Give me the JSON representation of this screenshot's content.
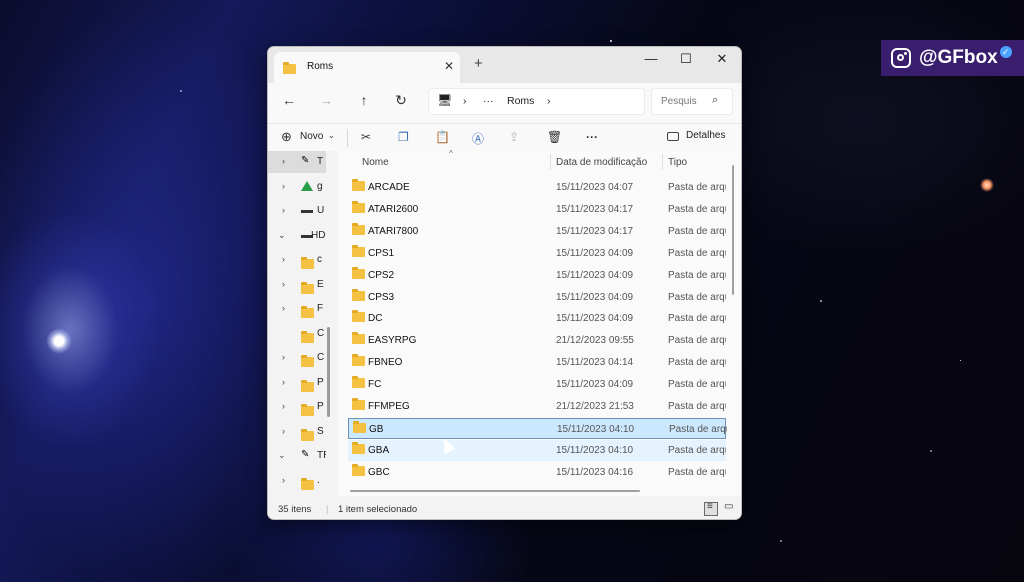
{
  "watermark": {
    "handle": "@GFbox",
    "icon": "instagram-icon"
  },
  "window": {
    "tab_title": "Roms",
    "tab_close": "✕",
    "new_tab": "+",
    "controls": {
      "minimize": "—",
      "maximize": "☐",
      "close": "✕"
    }
  },
  "nav": {
    "back": "←",
    "forward": "→",
    "up": "↑",
    "refresh": "↻",
    "breadcrumb": {
      "more": "···",
      "current": "Roms",
      "sep": "›"
    },
    "search_placeholder": "Pesquis"
  },
  "commandbar": {
    "new_label": "Novo",
    "details_label": "Detalhes",
    "more": "···"
  },
  "nav_pane": [
    {
      "chevron": "›",
      "icon": "pin-icon",
      "label": "T",
      "selected": true
    },
    {
      "chevron": "›",
      "icon": "google-drive-icon",
      "label": "g"
    },
    {
      "chevron": "›",
      "icon": "drive-icon",
      "label": "U"
    },
    {
      "chevron": "⌄",
      "icon": "drive-icon",
      "label": "HD"
    },
    {
      "chevron": "›",
      "icon": "folder-icon",
      "label": "c"
    },
    {
      "chevron": "›",
      "icon": "folder-icon",
      "label": "E"
    },
    {
      "chevron": "›",
      "icon": "folder-icon",
      "label": "F"
    },
    {
      "chevron": "",
      "icon": "folder-icon",
      "label": "C"
    },
    {
      "chevron": "›",
      "icon": "folder-icon",
      "label": "C"
    },
    {
      "chevron": "›",
      "icon": "folder-icon",
      "label": "P"
    },
    {
      "chevron": "›",
      "icon": "folder-icon",
      "label": "P"
    },
    {
      "chevron": "›",
      "icon": "folder-icon",
      "label": "S"
    },
    {
      "chevron": "⌄",
      "icon": "pin-icon",
      "label": "TR"
    },
    {
      "chevron": "›",
      "icon": "folder-icon",
      "label": "."
    }
  ],
  "columns": {
    "name": "Nome",
    "date": "Data de modificação",
    "type": "Tipo"
  },
  "files": [
    {
      "name": "ARCADE",
      "date": "15/11/2023 04:07",
      "type": "Pasta de arquivos"
    },
    {
      "name": "ATARI2600",
      "date": "15/11/2023 04:17",
      "type": "Pasta de arquivos"
    },
    {
      "name": "ATARI7800",
      "date": "15/11/2023 04:17",
      "type": "Pasta de arquivos"
    },
    {
      "name": "CPS1",
      "date": "15/11/2023 04:09",
      "type": "Pasta de arquivos"
    },
    {
      "name": "CPS2",
      "date": "15/11/2023 04:09",
      "type": "Pasta de arquivos"
    },
    {
      "name": "CPS3",
      "date": "15/11/2023 04:09",
      "type": "Pasta de arquivos"
    },
    {
      "name": "DC",
      "date": "15/11/2023 04:09",
      "type": "Pasta de arquivos"
    },
    {
      "name": "EASYRPG",
      "date": "21/12/2023 09:55",
      "type": "Pasta de arquivos"
    },
    {
      "name": "FBNEO",
      "date": "15/11/2023 04:14",
      "type": "Pasta de arquivos"
    },
    {
      "name": "FC",
      "date": "15/11/2023 04:09",
      "type": "Pasta de arquivos"
    },
    {
      "name": "FFMPEG",
      "date": "21/12/2023 21:53",
      "type": "Pasta de arquivos"
    },
    {
      "name": "GB",
      "date": "15/11/2023 04:10",
      "type": "Pasta de arquivos",
      "state": "selected"
    },
    {
      "name": "GBA",
      "date": "15/11/2023 04:10",
      "type": "Pasta de arquivos",
      "state": "hover"
    },
    {
      "name": "GBC",
      "date": "15/11/2023 04:16",
      "type": "Pasta de arquivos"
    }
  ],
  "status": {
    "item_count": "35 itens",
    "selection": "1 item selecionado"
  },
  "colors": {
    "selection_bg": "#cce8ff",
    "selection_border": "#6f91b5",
    "folder": "#f4c142",
    "badge_bg": "#3a1e6e"
  }
}
